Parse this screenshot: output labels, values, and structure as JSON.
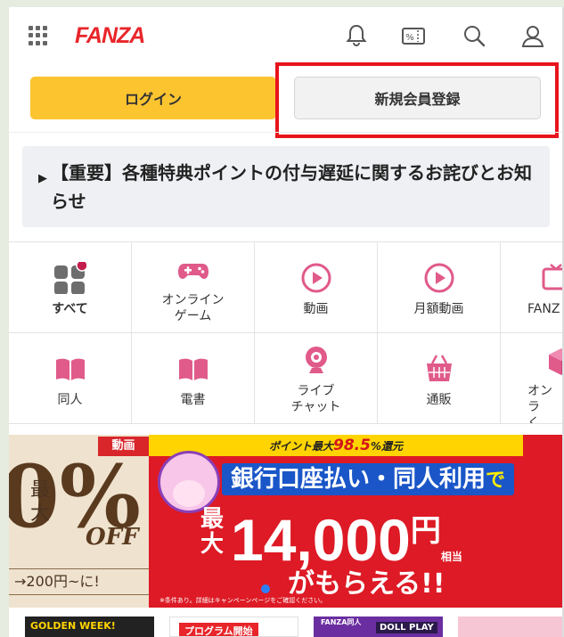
{
  "header": {
    "logo": "FANZA",
    "icons": [
      "menu-grid-icon",
      "bell-icon",
      "coupon-icon",
      "search-icon",
      "user-icon"
    ],
    "coupon_glyph": "%"
  },
  "auth": {
    "login_label": "ログイン",
    "register_label": "新規会員登録"
  },
  "notice": {
    "marker": "▶",
    "text": "【重要】各種特典ポイントの付与遅延に関するお詫びとお知らせ"
  },
  "categories": [
    {
      "label": "すべて",
      "icon": "all-grid-icon"
    },
    {
      "label": "オンライン\nゲーム",
      "icon": "gamepad-icon"
    },
    {
      "label": "動画",
      "icon": "play-circle-icon"
    },
    {
      "label": "月額動画",
      "icon": "play-circle-icon"
    },
    {
      "label": "FANZ",
      "icon": "tv-icon"
    },
    {
      "label": "同人",
      "icon": "book-icon"
    },
    {
      "label": "電書",
      "icon": "book-icon"
    },
    {
      "label": "ライブ\nチャット",
      "icon": "webcam-icon"
    },
    {
      "label": "通販",
      "icon": "basket-icon"
    },
    {
      "label": "オンラ\nく",
      "icon": "box-icon"
    }
  ],
  "banner": {
    "left": {
      "tag": "動画",
      "kanji_top": "最",
      "kanji_bottom": "大",
      "big_text": "0%",
      "off_text": "OFF",
      "price_text": "→200円~に!"
    },
    "right": {
      "strip_prefix": "ポイント最大",
      "strip_value": "98.5",
      "strip_suffix": "%還元",
      "bank_text": "銀行口座払い・同人利用",
      "bank_suffix": "で",
      "max_text": "最大",
      "amount": "14,000",
      "yen": "円",
      "equiv": "相当",
      "get_text": "がもらえる!!",
      "fine_print": "※条件あり。詳細はキャンペーンページをご確認ください。"
    }
  },
  "thumbs": [
    "GOLDEN WEEK!",
    "プログラム開始",
    "FANZA同人",
    "DOLL PLAY"
  ],
  "colors": {
    "brand": "#e8252a",
    "login": "#fcc42f",
    "icon_pink": "#e05a8a",
    "highlight": "#e8141c",
    "banner_red": "#dd1a25"
  }
}
